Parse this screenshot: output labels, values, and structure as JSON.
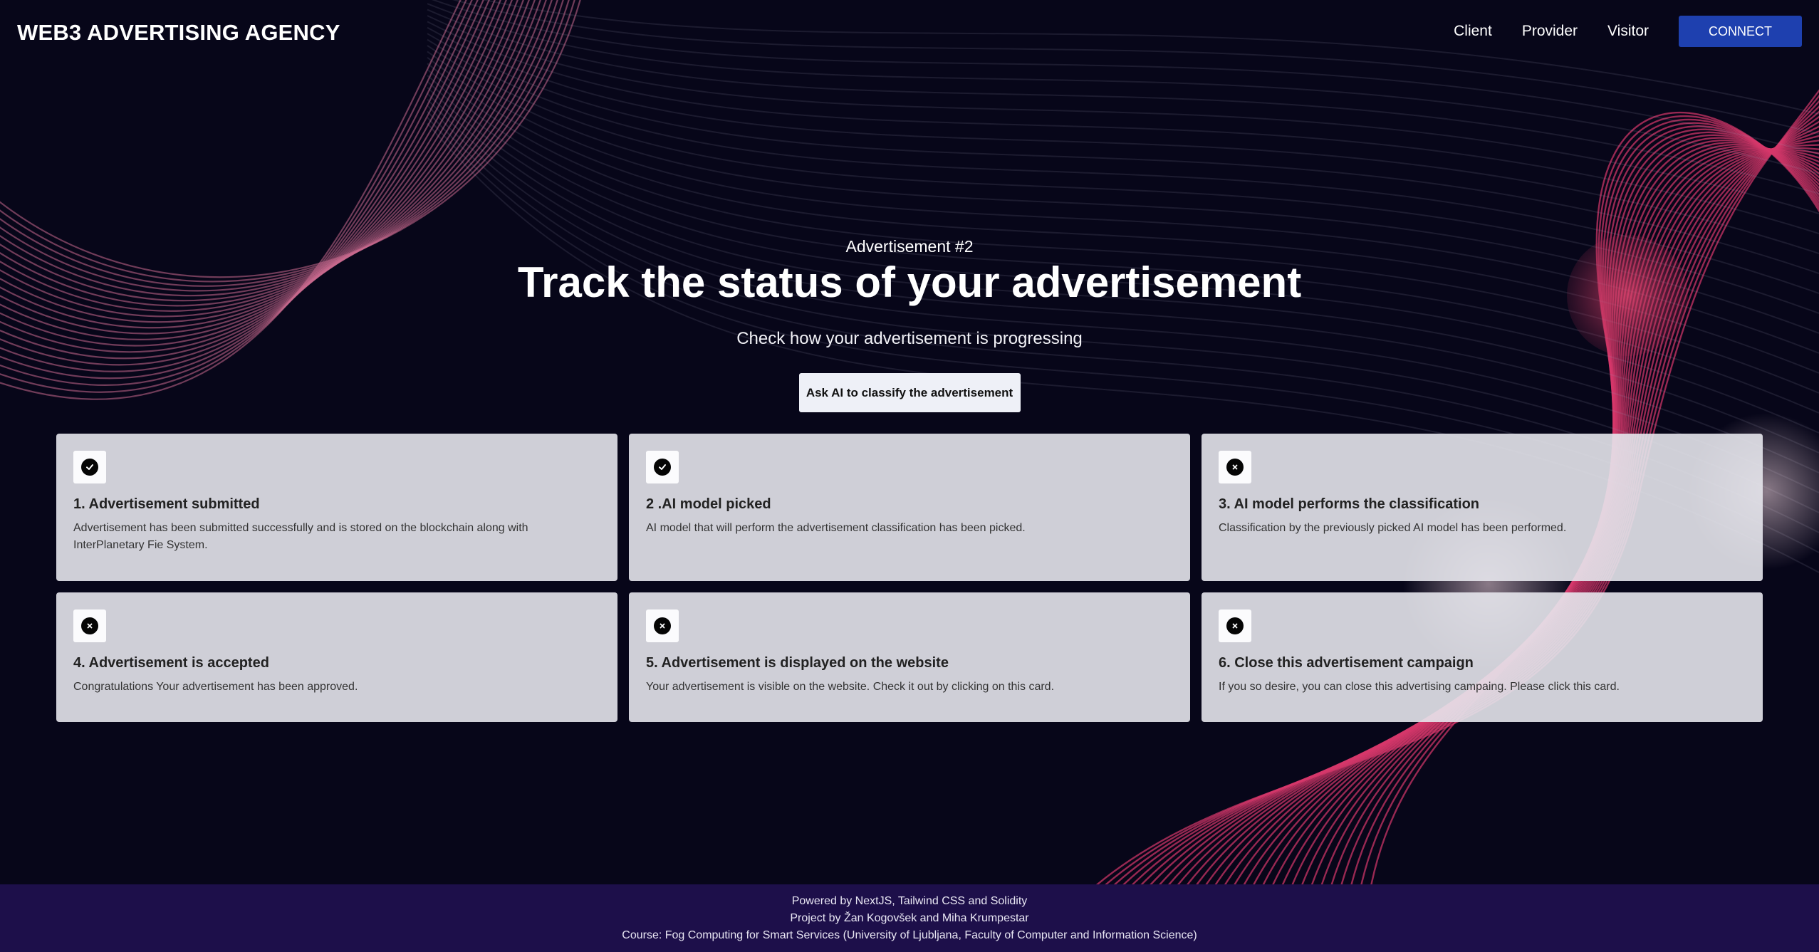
{
  "header": {
    "logo": "WEB3 ADVERTISING AGENCY",
    "nav": [
      "Client",
      "Provider",
      "Visitor"
    ],
    "connect_label": "CONNECT"
  },
  "hero": {
    "subtitle": "Advertisement #2",
    "title": "Track the status of your advertisement",
    "description": "Check how your advertisement is progressing",
    "ask_button": "Ask AI to classify the advertisement"
  },
  "steps": [
    {
      "title": "1. Advertisement submitted",
      "description": "Advertisement has been submitted successfully and is stored on the blockchain along with InterPlanetary Fie System.",
      "status": "done",
      "icon": "check-icon"
    },
    {
      "title": "2 .AI model picked",
      "description": "AI model that will perform the advertisement classification has been picked.",
      "status": "done",
      "icon": "check-icon"
    },
    {
      "title": "3. AI model performs the classification",
      "description": "Classification by the previously picked AI model has been performed.",
      "status": "pending",
      "icon": "close-icon"
    },
    {
      "title": "4. Advertisement is accepted",
      "description": "Congratulations Your advertisement has been approved.",
      "status": "pending",
      "icon": "close-icon"
    },
    {
      "title": "5. Advertisement is displayed on the website",
      "description": "Your advertisement is visible on the website. Check it out by clicking on this card.",
      "status": "pending",
      "icon": "close-icon"
    },
    {
      "title": "6. Close this advertisement campaign",
      "description": "If you so desire, you can close this advertising campaing. Please click this card.",
      "status": "pending",
      "icon": "close-icon"
    }
  ],
  "footer": {
    "line1": "Powered by NextJS, Tailwind CSS and Solidity",
    "line2": "Project by Žan Kogovšek and Miha Krumpestar",
    "line3": "Course: Fog Computing for Smart Services (University of Ljubljana, Faculty of Computer and Information Science)"
  },
  "colors": {
    "background": "#070619",
    "accent": "#1e40af",
    "footer": "#1d0f4a",
    "wave_pink": "#d6386b"
  }
}
